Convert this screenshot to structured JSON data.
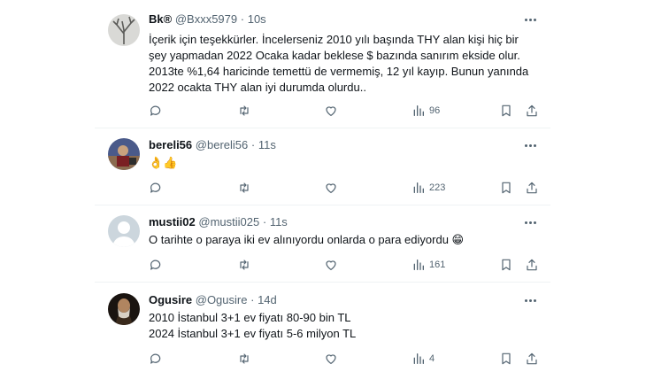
{
  "tweets": [
    {
      "name": "Bk®",
      "handle": "@Bxxx5979",
      "time": "10s",
      "lines": [
        "İçerik için teşekkürler. İncelerseniz 2010 yılı başında THY alan kişi hiç bir",
        "şey yapmadan 2022 Ocaka kadar beklese $ bazında sanırım ekside olur.",
        "2013te %1,64 haricinde temettü de vermemiş, 12 yıl kayıp. Bunun yanında",
        "2022 ocakta THY alan iyi durumda olurdu.."
      ],
      "views": "96"
    },
    {
      "name": "bereli56",
      "handle": "@bereli56",
      "time": "11s",
      "lines": [
        "👌👍"
      ],
      "views": "223"
    },
    {
      "name": "mustii02",
      "handle": "@mustii025",
      "time": "11s",
      "lines": [
        "O tarihte o paraya iki ev alınıyordu onlarda o para ediyordu 😁"
      ],
      "views": "161"
    },
    {
      "name": "Ogusire",
      "handle": "@Ogusire",
      "time": "14d",
      "lines": [
        "2010 İstanbul 3+1 ev fiyatı 80-90 bin TL",
        "2024 İstanbul 3+1 ev fiyatı 5-6 milyon TL"
      ],
      "views": "4"
    }
  ],
  "separator_dot": "·",
  "icons": [
    "reply-icon",
    "retweet-icon",
    "like-icon",
    "views-icon",
    "bookmark-icon",
    "share-icon",
    "more-icon"
  ],
  "colors": {
    "text": "#0f1419",
    "secondary": "#536471",
    "divider": "#eff3f4"
  }
}
